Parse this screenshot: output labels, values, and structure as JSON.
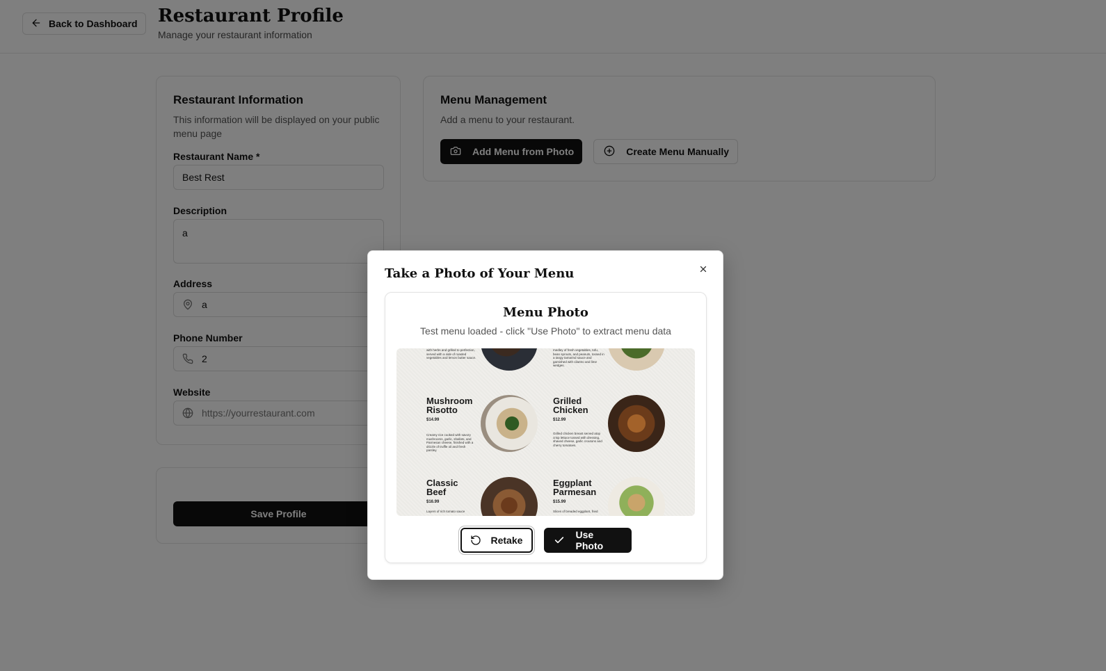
{
  "header": {
    "back_label": "Back to Dashboard",
    "title": "Restaurant Profile",
    "subtitle": "Manage your restaurant information"
  },
  "info_card": {
    "title": "Restaurant Information",
    "description": "This information will be displayed on your public menu page",
    "fields": {
      "name": {
        "label": "Restaurant Name *",
        "value": "Best Rest"
      },
      "description": {
        "label": "Description",
        "value": "a"
      },
      "address": {
        "label": "Address",
        "value": "a",
        "icon": "map-pin-icon"
      },
      "phone": {
        "label": "Phone Number",
        "value": "2",
        "icon": "phone-icon"
      },
      "website": {
        "label": "Website",
        "value": "",
        "placeholder": "https://yourrestaurant.com",
        "icon": "globe-icon"
      }
    }
  },
  "menu_card": {
    "title": "Menu Management",
    "description": "Add a menu to your restaurant.",
    "add_photo_label": "Add Menu from Photo",
    "create_manual_label": "Create Menu Manually"
  },
  "save_card": {
    "save_label": "Save Profile"
  },
  "modal": {
    "title": "Take a Photo of Your Menu",
    "photo_title": "Menu Photo",
    "photo_description": "Test menu loaded - click \"Use Photo\" to extract menu data",
    "retake_label": "Retake",
    "use_label": "Use Photo",
    "menu_items": [
      {
        "name_line1": "Mushroom",
        "name_line2": "Risotto",
        "price": "$14.99",
        "text": "Creamy rice cooked with savory mushrooms, garlic, shallots, and Parmesan cheese, finished with a drizzle of truffle oil and fresh parsley."
      },
      {
        "name_line1": "Grilled",
        "name_line2": "Chicken",
        "price": "$12.99",
        "text": "Grilled chicken breast served atop crisp lettuce tossed with dressing, shaved cheese, garlic croutons and cherry tomatoes."
      },
      {
        "name_line1": "Classic",
        "name_line2": "Beef",
        "price": "$16.99",
        "text": "Layers of rich tomato sauce"
      },
      {
        "name_line1": "Eggplant",
        "name_line2": "Parmesan",
        "price": "$15.99",
        "text": "Slices of breaded eggplant, fried"
      }
    ],
    "top_text_left": "with herbs and grilled to perfection, served with a side of roasted vegetables and lemon butter sauce.",
    "top_text_right": "medley of fresh vegetables, tofu, bean sprouts, and peanuts, tossed in a tangy tamarind sauce and garnished with cilantro and lime wedges."
  },
  "colors": {
    "primary": "#111111",
    "border": "#e3e3e3",
    "muted_text": "#555555",
    "overlay": "rgba(0,0,0,0.5)"
  }
}
